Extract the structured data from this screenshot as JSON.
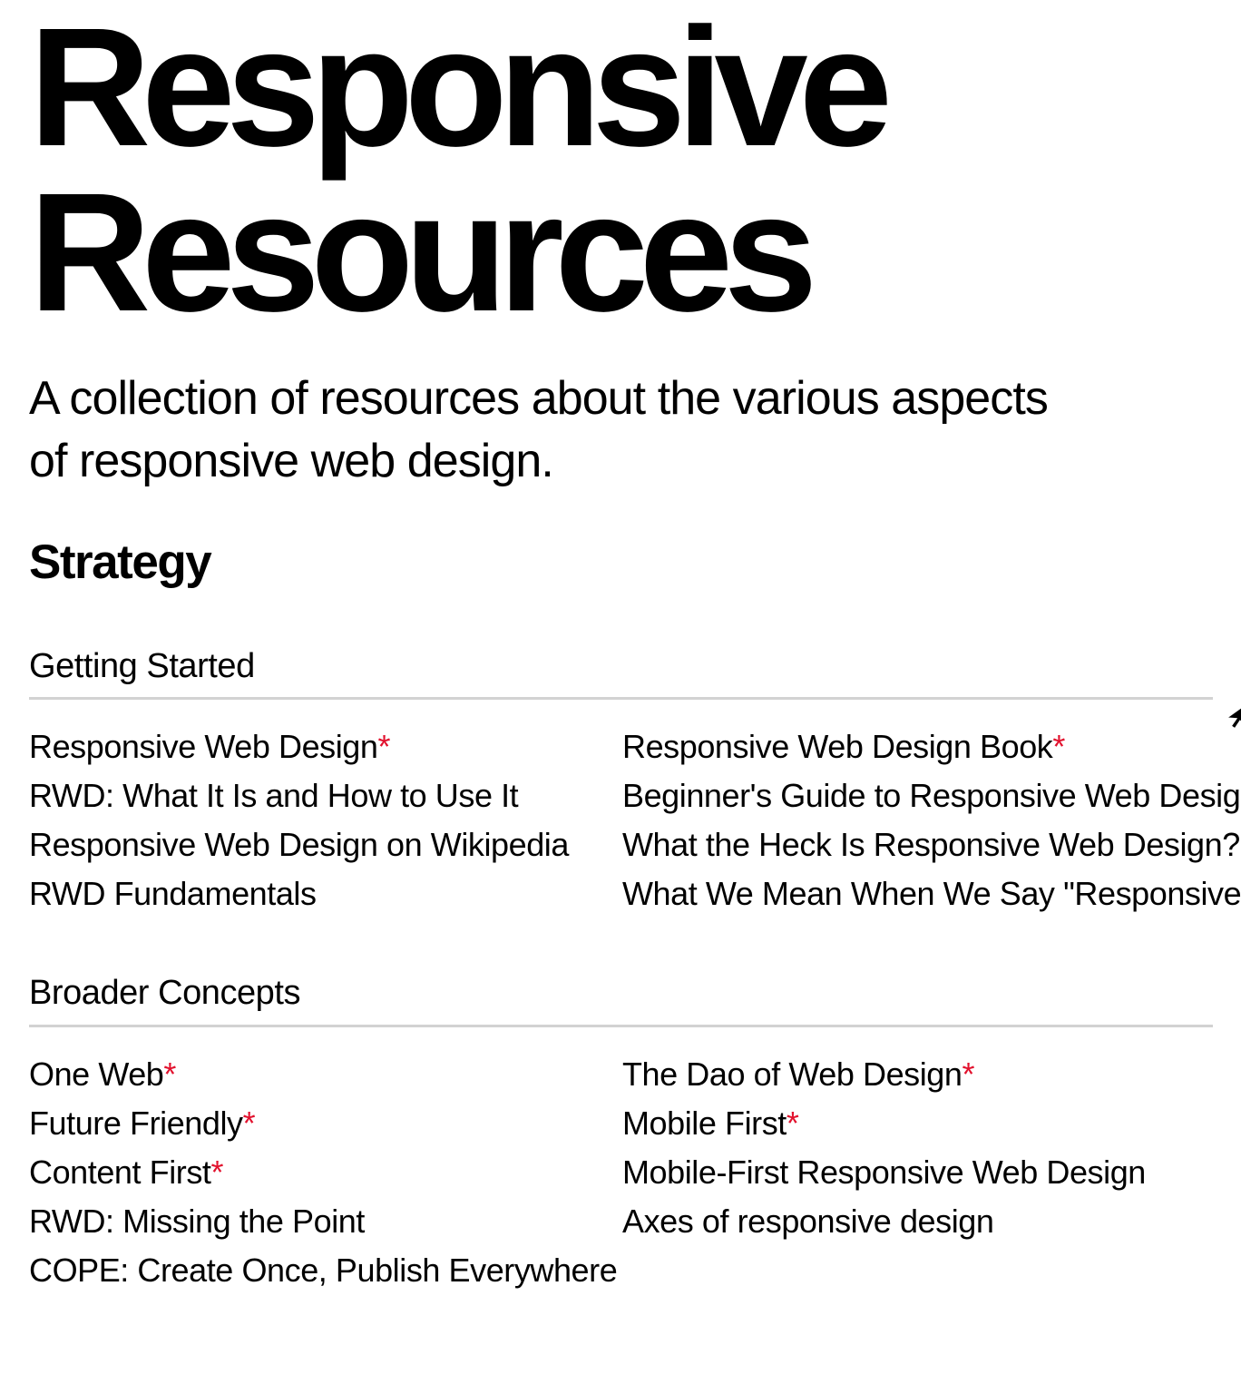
{
  "site": {
    "title": "Responsive\nResources",
    "tagline": "A collection of resources about the various aspects of responsive web design."
  },
  "category": {
    "heading": "Strategy"
  },
  "colors": {
    "text": "#000000",
    "star_accent": "#e2122e",
    "rule": "#d2d2d2",
    "background": "#ffffff"
  },
  "legend": {
    "star_glyph": "*"
  },
  "groups": [
    {
      "title": "Getting Started",
      "columns": [
        {
          "links": [
            {
              "label": "Responsive Web Design",
              "starred": true
            },
            {
              "label": "RWD: What It Is and How to Use It",
              "starred": false
            },
            {
              "label": "Responsive Web Design on Wikipedia",
              "starred": false
            },
            {
              "label": "RWD Fundamentals",
              "starred": false
            }
          ]
        },
        {
          "links": [
            {
              "label": "Responsive Web Design Book",
              "starred": true
            },
            {
              "label": "Beginner's Guide to Responsive Web Design",
              "starred": false
            },
            {
              "label": "What the Heck Is Responsive Web Design?",
              "starred": false
            },
            {
              "label": "What We Mean When We Say \"Responsive\"",
              "starred": false
            }
          ]
        }
      ]
    },
    {
      "title": "Broader Concepts",
      "columns": [
        {
          "links": [
            {
              "label": "One Web",
              "starred": true
            },
            {
              "label": "Future Friendly",
              "starred": true
            },
            {
              "label": "Content First",
              "starred": true
            },
            {
              "label": "RWD: Missing the Point",
              "starred": false
            },
            {
              "label": "COPE: Create Once, Publish Everywhere",
              "starred": false
            }
          ]
        },
        {
          "links": [
            {
              "label": "The Dao of Web Design",
              "starred": true
            },
            {
              "label": "Mobile First",
              "starred": true
            },
            {
              "label": "Mobile-First Responsive Web Design",
              "starred": false
            },
            {
              "label": "Axes of responsive design",
              "starred": false
            }
          ]
        }
      ]
    }
  ]
}
